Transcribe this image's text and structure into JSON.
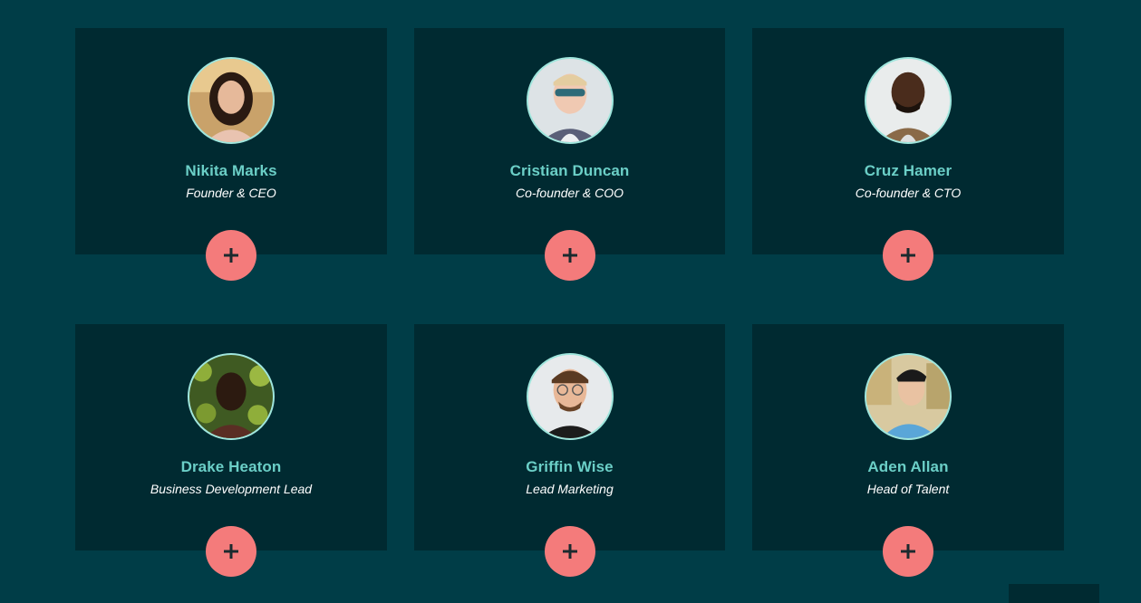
{
  "colors": {
    "page_background": "#003d47",
    "card_background": "#002a31",
    "name_text": "#6bcfc7",
    "role_text": "#ffffff",
    "button_background": "#f47b7b",
    "button_icon": "#1b2a2e",
    "avatar_border": "#9fe6dd"
  },
  "team": [
    {
      "name": "Nikita Marks",
      "role": "Founder & CEO",
      "button_icon": "plus-icon"
    },
    {
      "name": "Cristian Duncan",
      "role": "Co-founder & COO",
      "button_icon": "plus-icon"
    },
    {
      "name": "Cruz Hamer",
      "role": "Co-founder & CTO",
      "button_icon": "plus-icon"
    },
    {
      "name": "Drake Heaton",
      "role": "Business Development Lead",
      "button_icon": "plus-icon"
    },
    {
      "name": "Griffin Wise",
      "role": "Lead Marketing",
      "button_icon": "plus-icon"
    },
    {
      "name": "Aden Allan",
      "role": "Head of Talent",
      "button_icon": "plus-icon"
    }
  ]
}
